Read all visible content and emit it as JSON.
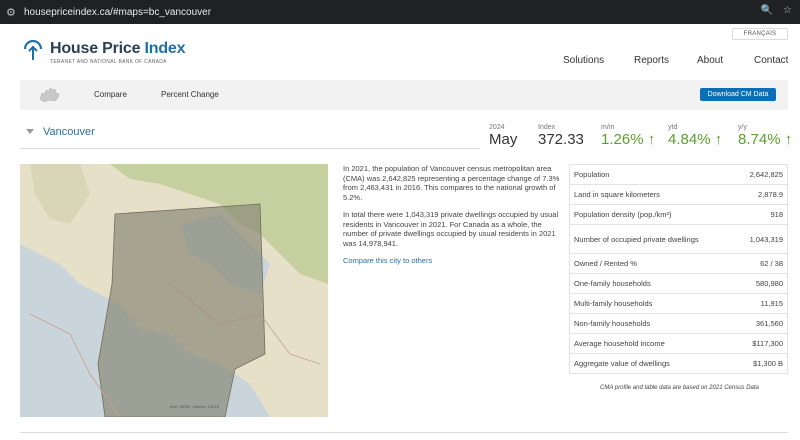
{
  "browser": {
    "url": "housepriceindex.ca/#maps=bc_vancouver"
  },
  "header": {
    "lang": "FRANÇAIS",
    "logo": {
      "name_plain": "House Price ",
      "name_accent": "Index",
      "tagline": "TERANET AND NATIONAL BANK OF CANADA"
    },
    "nav": [
      {
        "label": "Solutions"
      },
      {
        "label": "Reports"
      },
      {
        "label": "About"
      },
      {
        "label": "Contact"
      }
    ]
  },
  "subbar": {
    "compare": "Compare",
    "percent_change": "Percent Change",
    "download": "Download CM Data"
  },
  "city": {
    "name": "Vancouver"
  },
  "stats": {
    "year": "2024",
    "month": "May",
    "index_label": "Index",
    "index_value": "372.33",
    "mm_label": "m/m",
    "mm_value": "1.26% ↑",
    "ytd_label": "ytd",
    "ytd_value": "4.84% ↑",
    "yy_label": "y/y",
    "yy_value": "8.74% ↑"
  },
  "description": {
    "p1": "In 2021, the population of Vancouver census metropolitan area (CMA) was 2,642,825 representing a percentage change of 7.3% from 2,463,431 in 2016. This compares to the national growth of 5.2%.",
    "p2": "In total there were 1,043,319 private dwellings occupied by usual residents in Vancouver in 2021. For Canada as a whole, the number of private dwellings occupied by usual residents in 2021 was 14,978,941.",
    "link": "Compare this city to others"
  },
  "table": [
    {
      "label": "Population",
      "value": "2,642,825"
    },
    {
      "label": "Land in square kilometers",
      "value": "2,878.9"
    },
    {
      "label": "Population density (pop./km²)",
      "value": "918"
    },
    {
      "label": "Number of occupied private dwellings",
      "value": "1,043,319"
    },
    {
      "label": "Owned / Rented %",
      "value": "62 / 38"
    },
    {
      "label": "One-family households",
      "value": "580,980"
    },
    {
      "label": "Multi-family households",
      "value": "11,915"
    },
    {
      "label": "Non-family households",
      "value": "361,560"
    },
    {
      "label": "Average household income",
      "value": "$117,300"
    },
    {
      "label": "Aggregate value of dwellings",
      "value": "$1,300 B"
    }
  ],
  "note": "CMA profile and table data are based on 2021 Census Data",
  "colors": {
    "accent": "#0b6fb8",
    "green": "#5aa02c",
    "link": "#2b6fa3"
  }
}
